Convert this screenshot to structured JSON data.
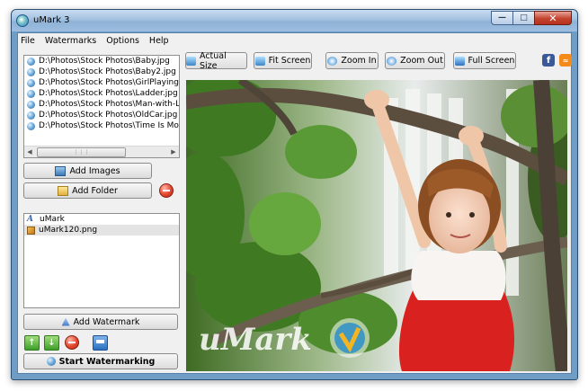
{
  "window": {
    "title": "uMark 3"
  },
  "menu": [
    "File",
    "Watermarks",
    "Options",
    "Help"
  ],
  "files": [
    "D:\\Photos\\Stock Photos\\Baby.jpg",
    "D:\\Photos\\Stock Photos\\Baby2.jpg",
    "D:\\Photos\\Stock Photos\\GirlPlaying.jpg",
    "D:\\Photos\\Stock Photos\\Ladder.jpg",
    "D:\\Photos\\Stock Photos\\Man-with-Lap",
    "D:\\Photos\\Stock Photos\\OldCar.jpg",
    "D:\\Photos\\Stock Photos\\Time Is Money"
  ],
  "buttons": {
    "add_images": "Add Images",
    "add_folder": "Add Folder",
    "add_watermark": "Add Watermark",
    "start": "Start Watermarking"
  },
  "watermarks": [
    "uMark",
    "uMark120.png"
  ],
  "toolbar": {
    "actual_size": "Actual Size",
    "fit_screen": "Fit Screen",
    "zoom_in": "Zoom In",
    "zoom_out": "Zoom Out",
    "full_screen": "Full Screen"
  },
  "preview": {
    "watermark_text": "uMark"
  },
  "social": {
    "facebook": "f"
  },
  "colors": {
    "accent": "#2a6fc0",
    "facebook": "#3b5998",
    "rss": "#f38a1a"
  }
}
